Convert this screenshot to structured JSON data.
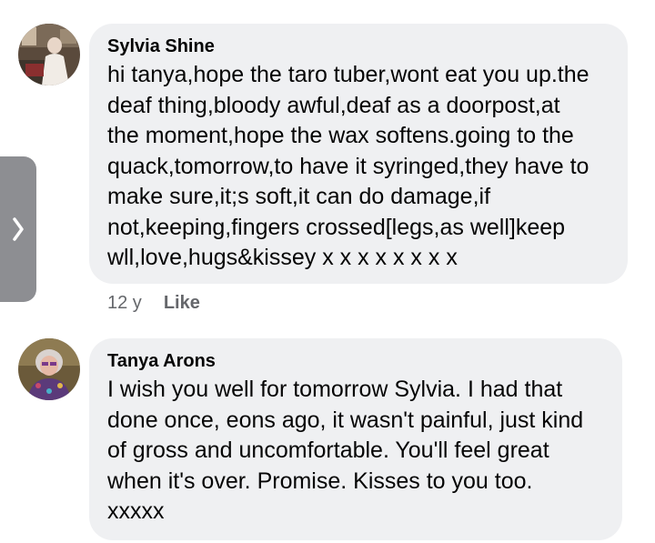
{
  "comments": [
    {
      "author": "Sylvia Shine",
      "text": "hi tanya,hope the taro tuber,wont eat you up.the\ndeaf thing,bloody awful,deaf as a doorpost,at\nthe moment,hope the wax softens.going to  the\nquack,tomorrow,to have it syringed,they have to\nmake sure,it;s soft,it can do damage,if\nnot,keeping,fingers crossed[legs,as well]keep\nwll,love,hugs&kissey x x x x x x x x",
      "time": "12 y",
      "like_label": "Like"
    },
    {
      "author": "Tanya Arons",
      "text": "I wish you well for tomorrow Sylvia.  I had that\ndone once, eons ago, it wasn't painful, just kind\nof gross and uncomfortable.  You'll feel great\nwhen it's over.  Promise.  Kisses to you too.\nxxxxx"
    }
  ],
  "icons": {
    "side_tab": "chevron-right-icon"
  },
  "colors": {
    "bubble": "#eff0f2",
    "meta_text": "#65676b",
    "side_tab": "#8d8e92"
  }
}
